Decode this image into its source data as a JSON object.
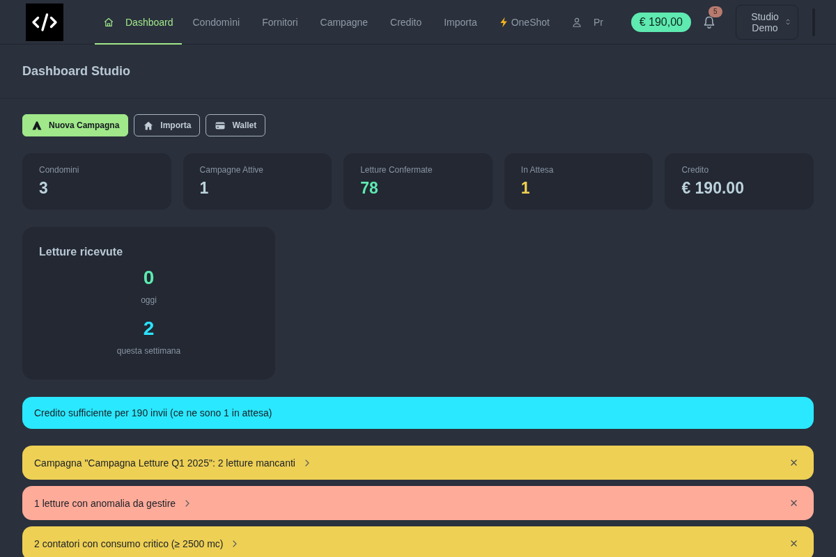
{
  "header": {
    "nav": [
      {
        "label": "Dashboard",
        "kind": "home",
        "selected": true
      },
      {
        "label": "Condomìni",
        "kind": "text",
        "selected": false
      },
      {
        "label": "Fornitori",
        "kind": "text",
        "selected": false
      },
      {
        "label": "Campagne",
        "kind": "text",
        "selected": false
      },
      {
        "label": "Credito",
        "kind": "text",
        "selected": false
      },
      {
        "label": "Importa",
        "kind": "text",
        "selected": false
      },
      {
        "label": "OneShot",
        "kind": "bolt",
        "selected": false
      },
      {
        "label": "Pr",
        "kind": "user",
        "selected": false
      }
    ],
    "balance": "€ 190,00",
    "notifications": {
      "count": "5"
    },
    "studio_selector": {
      "label": "Studio Demo"
    }
  },
  "page": {
    "title": "Dashboard Studio"
  },
  "actions": [
    {
      "label": "Nuova Campagna",
      "kind": "primary"
    },
    {
      "label": "Importa",
      "kind": "outline"
    },
    {
      "label": "Wallet",
      "kind": "outline"
    }
  ],
  "stats": [
    {
      "label": "Condomini",
      "value": "3",
      "color": "#bcd3dc"
    },
    {
      "label": "Campagne Attive",
      "value": "1",
      "color": "#bcd3dc"
    },
    {
      "label": "Letture Confermate",
      "value": "78",
      "color": "#5eeab0"
    },
    {
      "label": "In Attesa",
      "value": "1",
      "color": "#f0d050"
    },
    {
      "label": "Credito",
      "value": "€ 190.00",
      "color": "#bcd3dc"
    }
  ],
  "readings_card": {
    "title": "Letture ricevute",
    "readings": [
      {
        "value": "0",
        "caption": "oggi",
        "color": "#5eeab0"
      },
      {
        "value": "2",
        "caption": "questa settimana",
        "color": "#2ae3ff"
      }
    ]
  },
  "alerts": [
    {
      "kind": "info",
      "text": "Credito sufficiente per 190 invii (ce ne sono 1 in attesa)",
      "has_details": false,
      "dismissible": false
    },
    {
      "kind": "warning",
      "text": "Campagna \"Campagna Letture Q1 2025\": 2 letture mancanti",
      "has_details": true,
      "dismissible": true
    },
    {
      "kind": "error",
      "text": "1 letture con anomalia da gestire",
      "has_details": true,
      "dismissible": true
    },
    {
      "kind": "warning",
      "text": "2 contatori con consumo critico (≥ 2500 mc)",
      "has_details": true,
      "dismissible": true
    }
  ]
}
